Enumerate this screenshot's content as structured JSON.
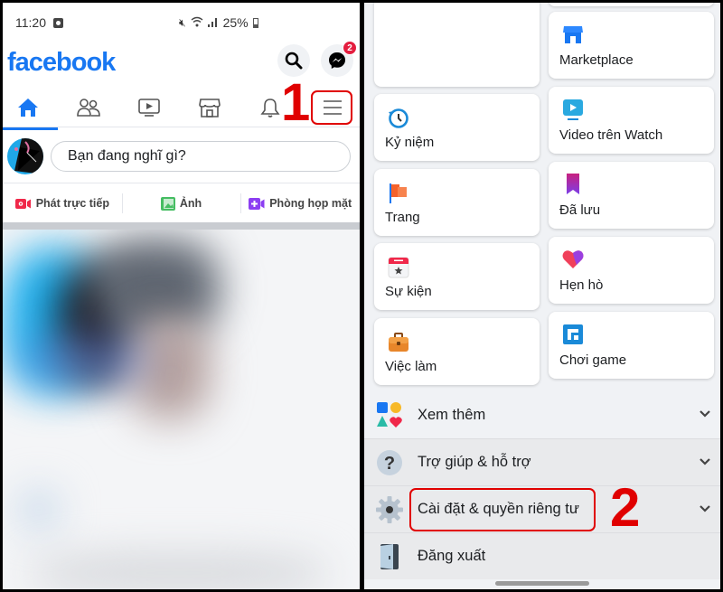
{
  "left_panel": {
    "status_bar": {
      "time": "11:20",
      "battery": "25%"
    },
    "header": {
      "logo": "facebook",
      "search_icon": "search-icon",
      "messenger_icon": "messenger-icon",
      "messenger_badge": "2"
    },
    "nav_tabs": [
      {
        "name": "home",
        "icon": "home-icon",
        "active": true
      },
      {
        "name": "friends",
        "icon": "friends-icon",
        "active": false
      },
      {
        "name": "watch",
        "icon": "video-icon",
        "active": false
      },
      {
        "name": "marketplace",
        "icon": "store-icon",
        "active": false
      },
      {
        "name": "notifications",
        "icon": "bell-icon",
        "active": false
      },
      {
        "name": "menu",
        "icon": "hamburger-menu-icon",
        "active": false
      }
    ],
    "annotation_1": "1",
    "composer": {
      "placeholder": "Bạn đang nghĩ gì?"
    },
    "actions": [
      {
        "label": "Phát trực tiếp",
        "icon": "live-video-icon",
        "color": "#f02849"
      },
      {
        "label": "Ảnh",
        "icon": "photo-icon",
        "color": "#45bd62"
      },
      {
        "label": "Phòng họp mặt",
        "icon": "room-icon",
        "color": "#8c3ef2"
      }
    ]
  },
  "right_panel": {
    "shortcuts": [
      {
        "label": "Marketplace",
        "icon": "marketplace-icon"
      },
      {
        "label": "Kỷ niệm",
        "icon": "memories-icon"
      },
      {
        "label": "Video trên Watch",
        "icon": "watch-icon"
      },
      {
        "label": "Trang",
        "icon": "pages-flag-icon"
      },
      {
        "label": "Đã lưu",
        "icon": "saved-bookmark-icon"
      },
      {
        "label": "Sự kiện",
        "icon": "events-calendar-icon"
      },
      {
        "label": "Hẹn hò",
        "icon": "dating-heart-icon"
      },
      {
        "label": "Việc làm",
        "icon": "jobs-briefcase-icon"
      },
      {
        "label": "Chơi game",
        "icon": "gaming-icon"
      }
    ],
    "menu_rows": [
      {
        "label": "Xem thêm",
        "icon": "see-more-icon",
        "expandable": true
      },
      {
        "label": "Trợ giúp & hỗ trợ",
        "icon": "help-icon",
        "expandable": true
      },
      {
        "label": "Cài đặt & quyền riêng tư",
        "icon": "settings-gear-icon",
        "expandable": true
      },
      {
        "label": "Đăng xuất",
        "icon": "logout-door-icon",
        "expandable": false
      }
    ],
    "annotation_2": "2"
  },
  "colors": {
    "brand": "#1877f2",
    "annotation": "#e00000",
    "badge": "#e41e3f"
  }
}
